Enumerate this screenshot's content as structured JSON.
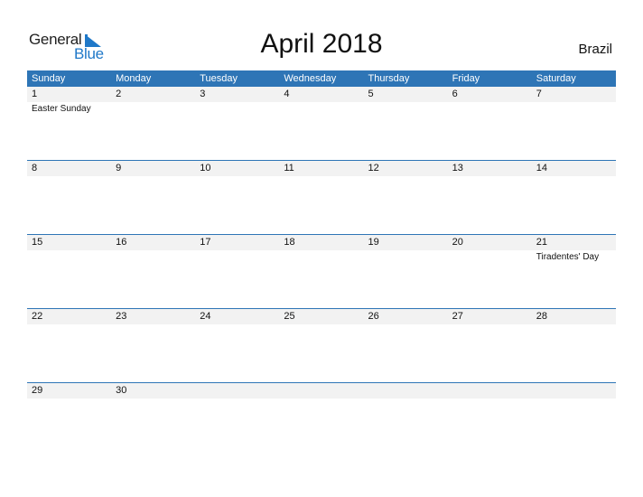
{
  "logo": {
    "line1": "General",
    "line2": "Blue",
    "accent": "#1f78c8"
  },
  "header": {
    "title": "April 2018",
    "country": "Brazil"
  },
  "colors": {
    "header_bg": "#2e75b6",
    "band_bg": "#f2f2f2"
  },
  "weekdays": [
    "Sunday",
    "Monday",
    "Tuesday",
    "Wednesday",
    "Thursday",
    "Friday",
    "Saturday"
  ],
  "weeks": [
    [
      {
        "day": "1",
        "holiday": "Easter Sunday"
      },
      {
        "day": "2",
        "holiday": ""
      },
      {
        "day": "3",
        "holiday": ""
      },
      {
        "day": "4",
        "holiday": ""
      },
      {
        "day": "5",
        "holiday": ""
      },
      {
        "day": "6",
        "holiday": ""
      },
      {
        "day": "7",
        "holiday": ""
      }
    ],
    [
      {
        "day": "8",
        "holiday": ""
      },
      {
        "day": "9",
        "holiday": ""
      },
      {
        "day": "10",
        "holiday": ""
      },
      {
        "day": "11",
        "holiday": ""
      },
      {
        "day": "12",
        "holiday": ""
      },
      {
        "day": "13",
        "holiday": ""
      },
      {
        "day": "14",
        "holiday": ""
      }
    ],
    [
      {
        "day": "15",
        "holiday": ""
      },
      {
        "day": "16",
        "holiday": ""
      },
      {
        "day": "17",
        "holiday": ""
      },
      {
        "day": "18",
        "holiday": ""
      },
      {
        "day": "19",
        "holiday": ""
      },
      {
        "day": "20",
        "holiday": ""
      },
      {
        "day": "21",
        "holiday": "Tiradentes' Day"
      }
    ],
    [
      {
        "day": "22",
        "holiday": ""
      },
      {
        "day": "23",
        "holiday": ""
      },
      {
        "day": "24",
        "holiday": ""
      },
      {
        "day": "25",
        "holiday": ""
      },
      {
        "day": "26",
        "holiday": ""
      },
      {
        "day": "27",
        "holiday": ""
      },
      {
        "day": "28",
        "holiday": ""
      }
    ],
    [
      {
        "day": "29",
        "holiday": ""
      },
      {
        "day": "30",
        "holiday": ""
      },
      {
        "day": "",
        "holiday": ""
      },
      {
        "day": "",
        "holiday": ""
      },
      {
        "day": "",
        "holiday": ""
      },
      {
        "day": "",
        "holiday": ""
      },
      {
        "day": "",
        "holiday": ""
      }
    ]
  ]
}
